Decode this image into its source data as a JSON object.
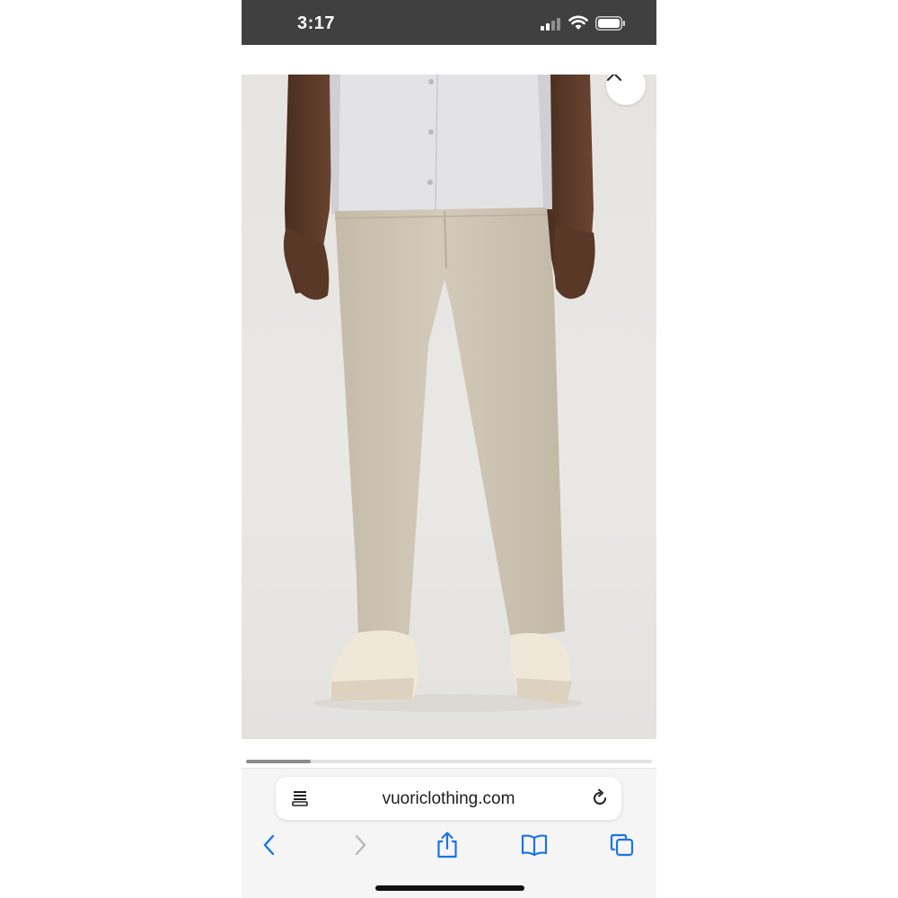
{
  "status_bar": {
    "time": "3:17",
    "signal_icon": "cellular-signal-icon",
    "wifi_icon": "wifi-icon",
    "battery_icon": "battery-icon"
  },
  "product_image": {
    "icon": "product-photo",
    "close_icon": "close-icon"
  },
  "carousel": {
    "progress_fraction": 0.16
  },
  "browser": {
    "url": "vuoriclothing.com",
    "reader_icon": "reader-mode-icon",
    "reload_icon": "reload-icon",
    "toolbar_icons": [
      "back-icon",
      "forward-icon",
      "share-icon",
      "bookmarks-icon",
      "tabs-icon"
    ]
  },
  "colors": {
    "status_bar_bg": "#404040",
    "accent": "#1a73e8",
    "pants": "#cdc4b3",
    "shirt": "#e4e4e7"
  }
}
